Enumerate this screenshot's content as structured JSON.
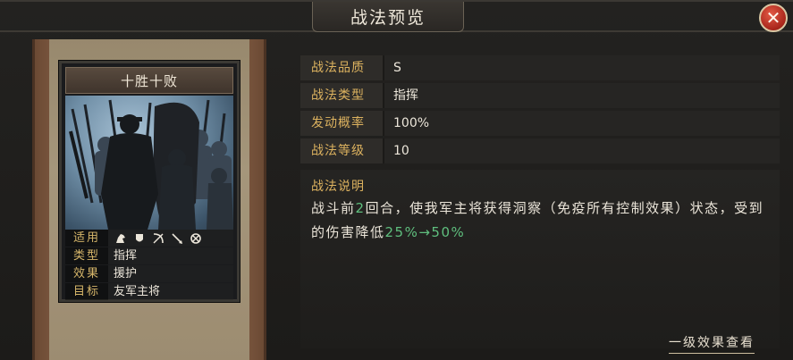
{
  "window": {
    "title": "战法预览",
    "close_label": "✕"
  },
  "card": {
    "name": "十胜十败",
    "stats": [
      {
        "key": "适用",
        "value": ""
      },
      {
        "key": "类型",
        "value": "指挥"
      },
      {
        "key": "效果",
        "value": "援护"
      },
      {
        "key": "目标",
        "value": "友军主将"
      }
    ],
    "troop_icons": [
      "cavalry-icon",
      "shield-icon",
      "bow-icon",
      "spear-icon",
      "siege-icon"
    ]
  },
  "details": {
    "rows": [
      {
        "key": "战法品质",
        "value": "S"
      },
      {
        "key": "战法类型",
        "value": "指挥"
      },
      {
        "key": "发动概率",
        "value": "100%"
      },
      {
        "key": "战法等级",
        "value": "10"
      }
    ],
    "description": {
      "heading": "战法说明",
      "text_part1": "战斗前",
      "highlight1": "2",
      "text_part2": "回合，使我军主将获得洞察（免疫所有控制效果）状态，受到的伤害降低",
      "highlight2": "25%→50%"
    },
    "level_effect_link": "一级效果查看"
  },
  "colors": {
    "gold": "#dcb25f",
    "highlight": "#5fbf7e",
    "close_red": "#c0392b"
  }
}
